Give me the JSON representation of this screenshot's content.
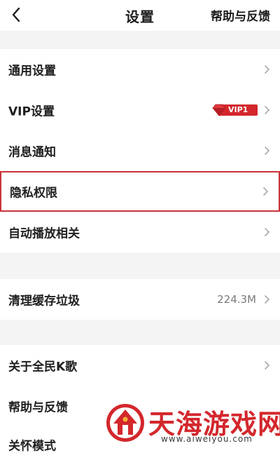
{
  "header": {
    "title": "设置",
    "help_label": "帮助与反馈"
  },
  "settings": [
    {
      "label": "通用设置"
    },
    {
      "label": "VIP设置",
      "badge": "VIP1"
    },
    {
      "label": "消息通知"
    },
    {
      "label": "隐私权限",
      "highlighted": true
    },
    {
      "label": "自动播放相关"
    },
    {
      "label": "清理缓存垃圾",
      "value": "224.3M"
    },
    {
      "label": "关于全民K歌"
    },
    {
      "label": "帮助与反馈"
    },
    {
      "label": "关怀模式"
    }
  ],
  "watermark": {
    "title": "天海游戏网",
    "url": "www.aiweiyou.com"
  },
  "colors": {
    "highlight_border": "#c8323a",
    "vip_badge": "#d3272c",
    "watermark": "#d3272c"
  }
}
